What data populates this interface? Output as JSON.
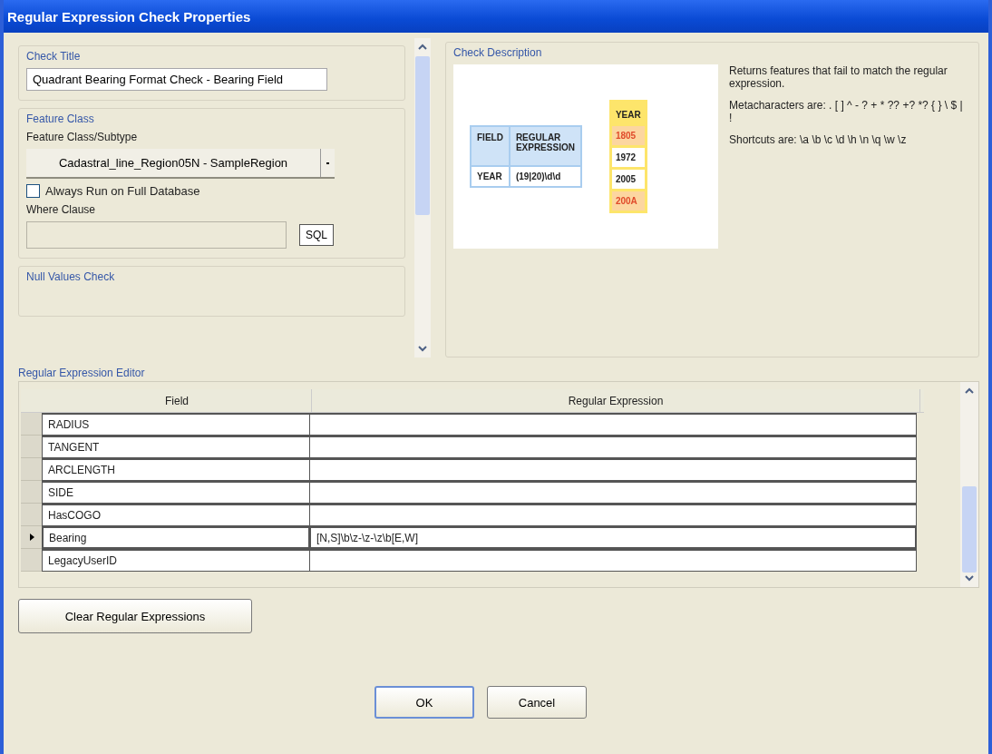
{
  "window": {
    "title": "Regular Expression Check Properties"
  },
  "check_title": {
    "label": "Check Title",
    "value": "Quadrant Bearing Format Check - Bearing Field"
  },
  "feature_class": {
    "label": "Feature Class",
    "subtype_label": "Feature Class/Subtype",
    "subtype_value": "Cadastral_line_Region05N - SampleRegion",
    "always_run": {
      "label": "Always Run on Full Database",
      "checked": false
    },
    "where_label": "Where Clause",
    "sql_button": "SQL"
  },
  "null_values": {
    "label": "Null Values Check"
  },
  "check_description": {
    "label": "Check Description",
    "figure": {
      "headers": [
        "FIELD",
        "REGULAR EXPRESSION"
      ],
      "row": [
        "YEAR",
        "(19|20)\\d\\d"
      ],
      "values_header": "YEAR",
      "values": [
        {
          "text": "1805",
          "matches": false
        },
        {
          "text": "1972",
          "matches": true
        },
        {
          "text": "2005",
          "matches": true
        },
        {
          "text": "200A",
          "matches": false
        }
      ]
    },
    "paragraphs": [
      "Returns features that fail to match the regular expression.",
      "Metacharacters are: . [ ] ^ - ? + * ?? +? *? { } \\ $ | !",
      "Shortcuts are: \\a \\b \\c \\d \\h \\n \\q \\w \\z"
    ]
  },
  "editor": {
    "label": "Regular Expression Editor",
    "columns": [
      "Field",
      "Regular Expression"
    ],
    "rows": [
      {
        "field": "RADIUS",
        "expression": "",
        "selected": false
      },
      {
        "field": "TANGENT",
        "expression": "",
        "selected": false
      },
      {
        "field": "ARCLENGTH",
        "expression": "",
        "selected": false
      },
      {
        "field": "SIDE",
        "expression": "",
        "selected": false
      },
      {
        "field": "HasCOGO",
        "expression": "",
        "selected": false
      },
      {
        "field": "Bearing",
        "expression": "[N,S]\\b\\z-\\z-\\z\\b[E,W]",
        "selected": true
      },
      {
        "field": "LegacyUserID",
        "expression": "",
        "selected": false
      }
    ]
  },
  "clear_button": "Clear Regular Expressions",
  "buttons": [
    "OK",
    "Cancel"
  ]
}
